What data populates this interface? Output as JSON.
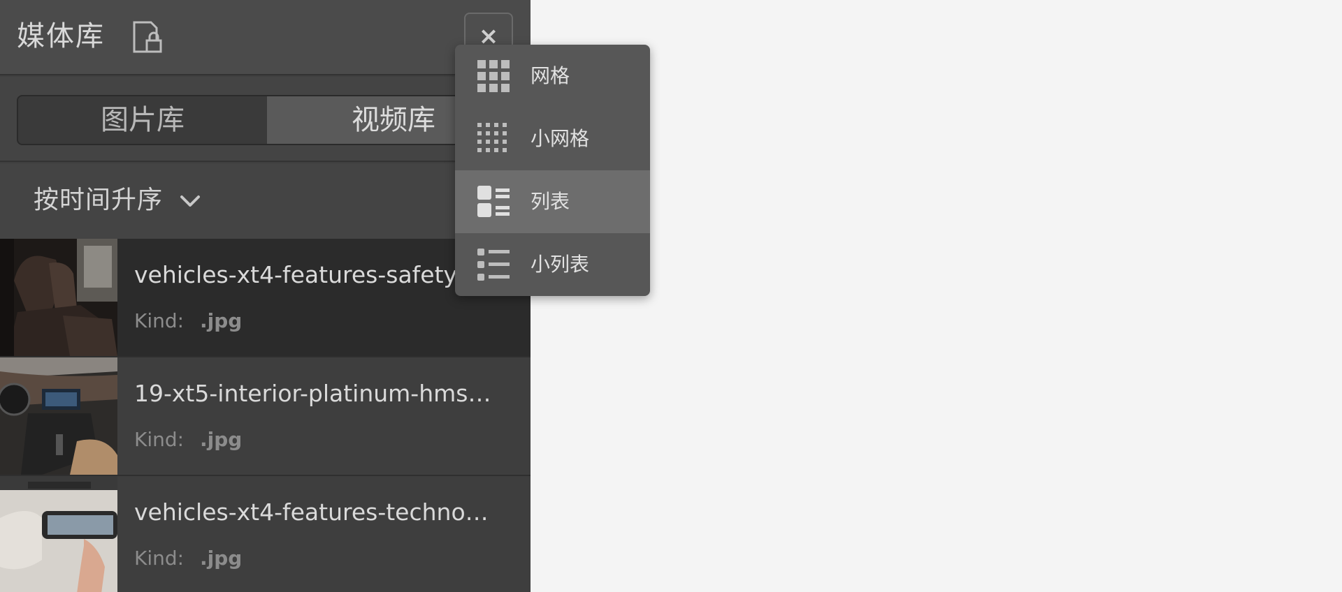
{
  "panel": {
    "title": "媒体库",
    "close_label": "×",
    "tabs": [
      {
        "label": "图片库",
        "selected": false
      },
      {
        "label": "视频库",
        "selected": true
      }
    ],
    "sort": {
      "label": "按时间升序"
    },
    "items": [
      {
        "name": "vehicles-xt4-features-safety",
        "kind_label": "Kind:",
        "kind": ".jpg",
        "selected": true
      },
      {
        "name": "19-xt5-interior-platinum-hms…",
        "kind_label": "Kind:",
        "kind": ".jpg",
        "selected": false
      },
      {
        "name": "vehicles-xt4-features-techno…",
        "kind_label": "Kind:",
        "kind": ".jpg",
        "selected": false
      }
    ]
  },
  "view_menu": {
    "items": [
      {
        "label": "网格",
        "icon": "grid-icon",
        "active": false
      },
      {
        "label": "小网格",
        "icon": "small-grid-icon",
        "active": false
      },
      {
        "label": "列表",
        "icon": "list-icon",
        "active": true
      },
      {
        "label": "小列表",
        "icon": "small-list-icon",
        "active": false
      }
    ]
  },
  "colors": {
    "selection_border": "#59c27a",
    "panel_bg": "#3f3f3f",
    "menu_bg": "#575757"
  }
}
